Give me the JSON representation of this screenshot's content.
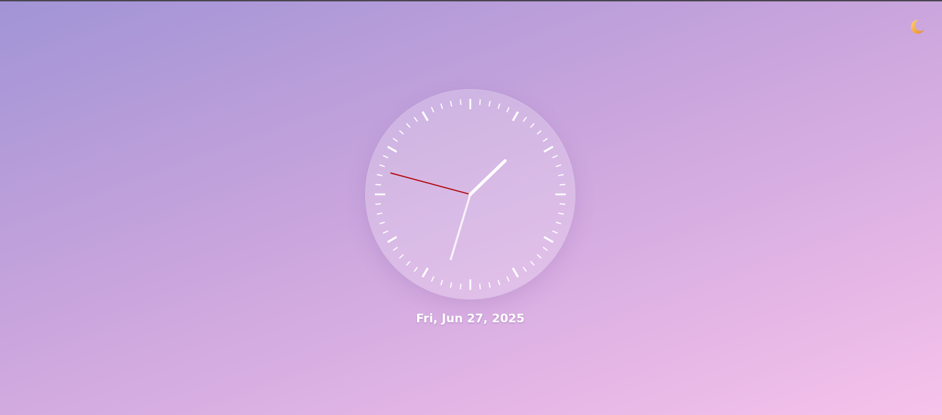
{
  "theme_toggle": {
    "icon": "crescent-moon-icon",
    "glyph": "🌙",
    "color": "#f0a23c"
  },
  "clock": {
    "hour": 1,
    "minute": 32,
    "second": 47.5,
    "face_color": "#d8b8e6",
    "hand_color": "#ffffff",
    "second_hand_color": "#b00000"
  },
  "date": {
    "text": "Fri, Jun 27, 2025"
  }
}
